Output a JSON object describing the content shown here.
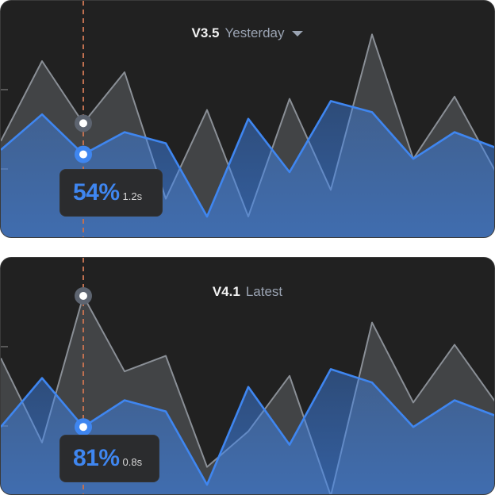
{
  "colors": {
    "background": "#212121",
    "gray_series": "#8a8f96",
    "blue_series": "#3f86f0",
    "cursor_line": "#c07050"
  },
  "charts": [
    {
      "version": "V3.5",
      "label": "Yesterday",
      "has_dropdown": true,
      "tooltip_value": "54%",
      "tooltip_time": "1.2s"
    },
    {
      "version": "V4.1",
      "label": "Latest",
      "has_dropdown": false,
      "tooltip_value": "81%",
      "tooltip_time": "0.8s"
    }
  ],
  "chart_data": [
    {
      "type": "area",
      "title": "V3.5 Yesterday",
      "x": [
        0,
        1,
        2,
        3,
        4,
        5,
        6,
        7,
        8,
        9,
        10,
        11,
        12
      ],
      "ylim": [
        0,
        100
      ],
      "cursor_index": 2,
      "series": [
        {
          "values": [
            44,
            80,
            52,
            75,
            18,
            58,
            10,
            63,
            22,
            92,
            36,
            64,
            30
          ]
        },
        {
          "values": [
            40,
            56,
            38,
            48,
            43,
            10,
            54,
            30,
            62,
            57,
            36,
            48,
            41
          ]
        }
      ]
    },
    {
      "type": "area",
      "title": "V4.1 Latest",
      "x": [
        0,
        1,
        2,
        3,
        4,
        5,
        6,
        7,
        8,
        9,
        10,
        11,
        12
      ],
      "ylim": [
        0,
        100
      ],
      "cursor_index": 2,
      "series": [
        {
          "values": [
            62,
            24,
            90,
            56,
            63,
            13,
            29,
            54,
            0,
            78,
            42,
            68,
            42
          ]
        },
        {
          "values": [
            31,
            53,
            31,
            43,
            38,
            5,
            49,
            23,
            57,
            51,
            31,
            43,
            36
          ]
        }
      ]
    }
  ]
}
